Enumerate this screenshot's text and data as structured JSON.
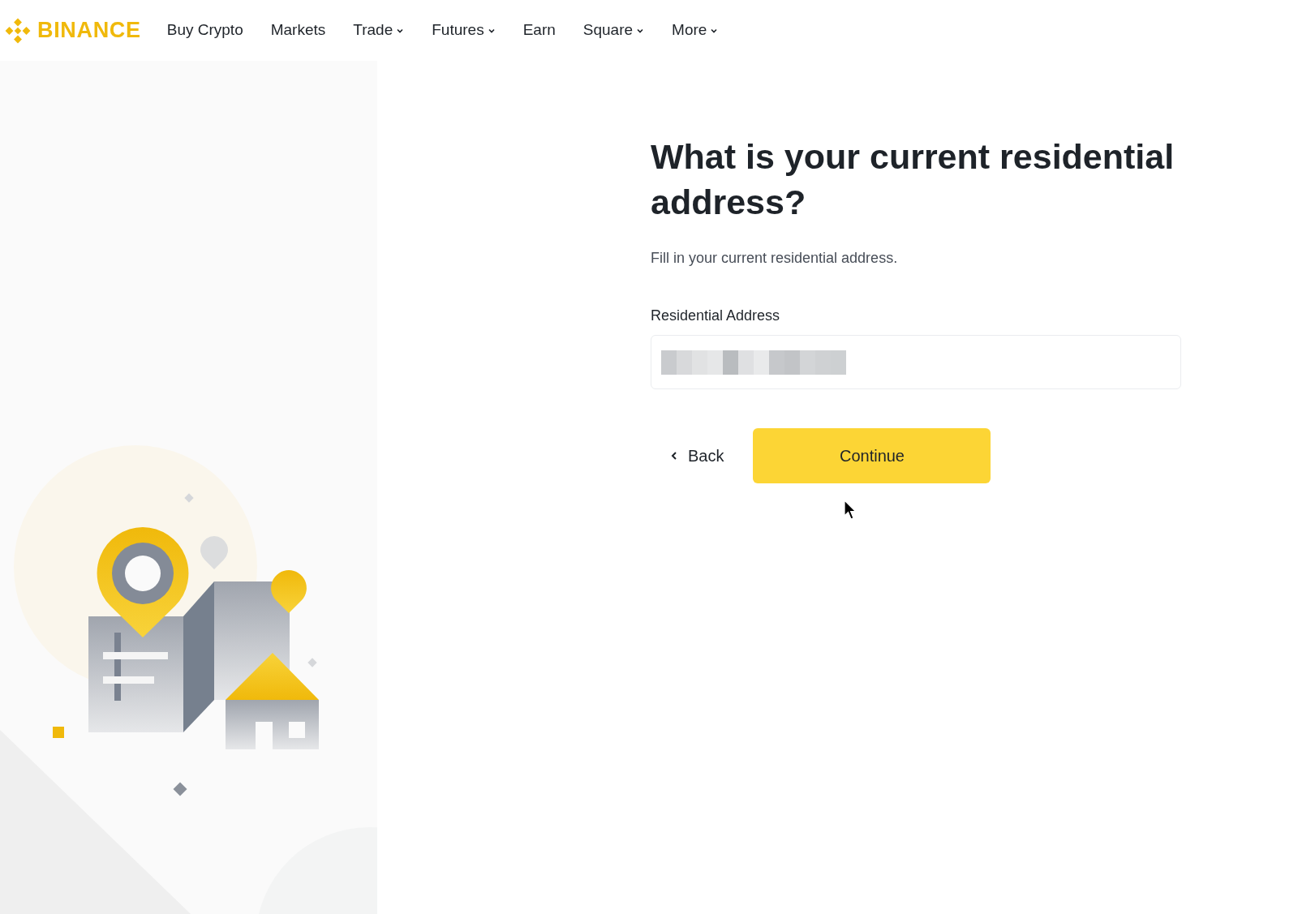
{
  "brand": {
    "name": "BINANCE"
  },
  "nav": [
    {
      "label": "Buy Crypto",
      "kind": "link"
    },
    {
      "label": "Markets",
      "kind": "link"
    },
    {
      "label": "Trade",
      "kind": "menu"
    },
    {
      "label": "Futures",
      "kind": "menu"
    },
    {
      "label": "Earn",
      "kind": "link"
    },
    {
      "label": "Square",
      "kind": "menu"
    },
    {
      "label": "More",
      "kind": "menu"
    }
  ],
  "form": {
    "title": "What is your current residential address?",
    "subtitle": "Fill in your current residential address.",
    "field": {
      "label": "Residential Address",
      "redacted": true
    }
  },
  "buttons": {
    "back": "Back",
    "continue": "Continue"
  }
}
